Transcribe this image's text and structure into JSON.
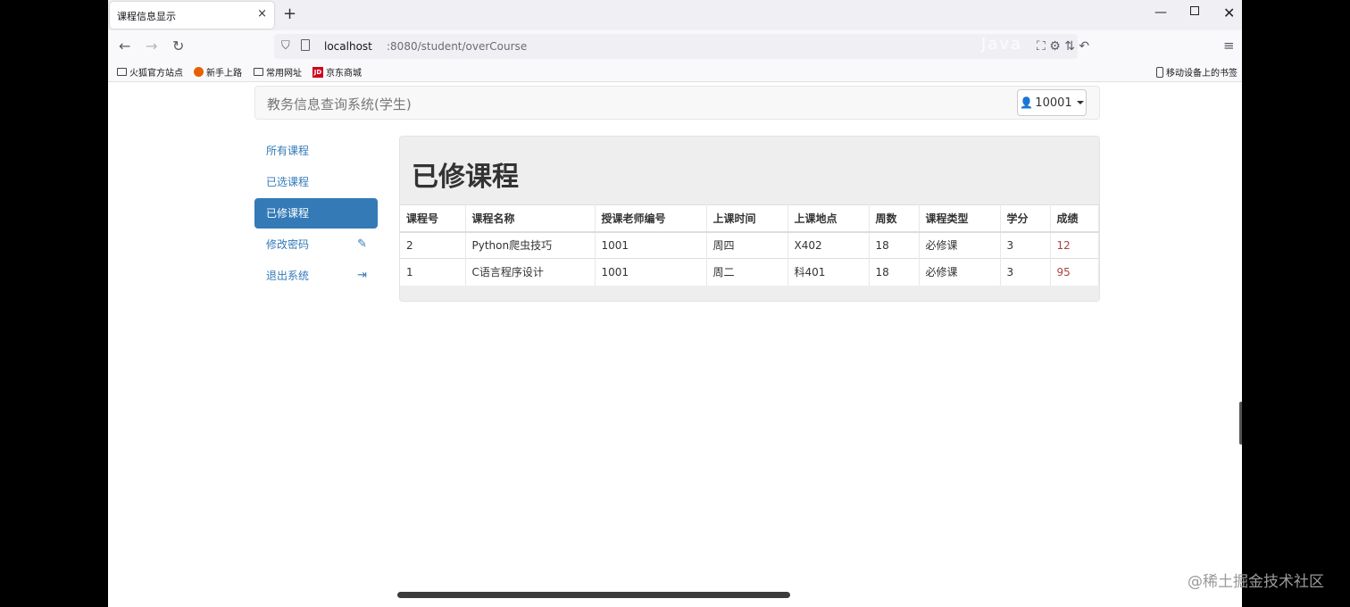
{
  "browser": {
    "tab_title": "课程信息显示",
    "tab_close": "×",
    "new_tab": "+",
    "url_host": "localhost",
    "url_path": ":8080/student/overCourse",
    "url_watermark": "Java",
    "bookmarks": [
      "火狐官方站点",
      "新手上路",
      "常用网址",
      "京东商城"
    ],
    "mobile_bookmarks": "移动设备上的书签"
  },
  "app": {
    "brand": "教务信息查询系统(学生)",
    "user": "10001",
    "sidebar": [
      {
        "label": "所有课程",
        "icon": ""
      },
      {
        "label": "已选课程",
        "icon": ""
      },
      {
        "label": "已修课程",
        "icon": "",
        "active": true
      },
      {
        "label": "修改密码",
        "icon": "pencil-icon"
      },
      {
        "label": "退出系统",
        "icon": "logout-icon"
      }
    ],
    "panel_title": "已修课程",
    "table": {
      "headers": [
        "课程号",
        "课程名称",
        "授课老师编号",
        "上课时间",
        "上课地点",
        "周数",
        "课程类型",
        "学分",
        "成绩"
      ],
      "rows": [
        [
          "2",
          "Python爬虫技巧",
          "1001",
          "周四",
          "X402",
          "18",
          "必修课",
          "3",
          "12"
        ],
        [
          "1",
          "C语言程序设计",
          "1001",
          "周二",
          "科401",
          "18",
          "必修课",
          "3",
          "95"
        ]
      ]
    }
  },
  "watermark": "@稀土掘金技术社区"
}
